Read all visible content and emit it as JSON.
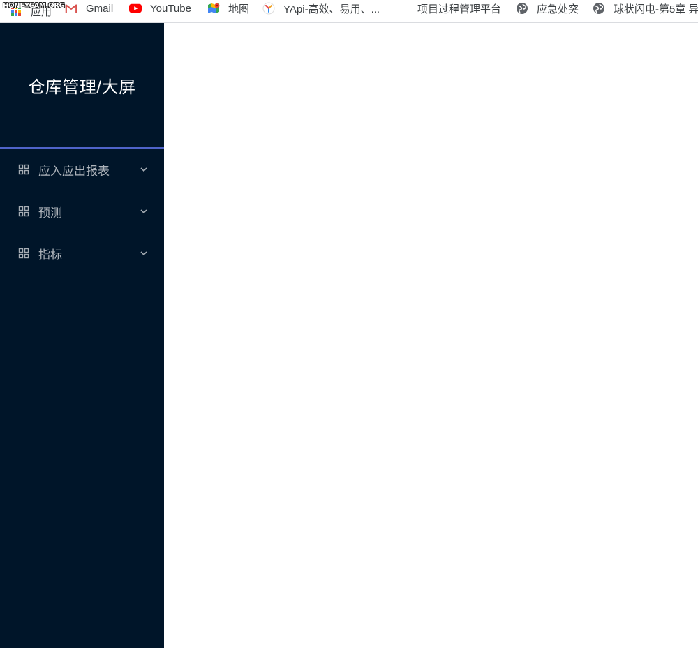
{
  "watermark": "HONEYCAM.ORG",
  "bookmarks": [
    {
      "label": "应用",
      "icon": "apps-grid-icon"
    },
    {
      "label": "Gmail",
      "icon": "gmail-icon"
    },
    {
      "label": "YouTube",
      "icon": "youtube-icon"
    },
    {
      "label": "地图",
      "icon": "maps-icon"
    },
    {
      "label": "YApi-高效、易用、...",
      "icon": "yapi-icon"
    },
    {
      "label": "项目过程管理平台",
      "icon": ""
    },
    {
      "label": "应急处突",
      "icon": "globe-icon"
    },
    {
      "label": "球状闪电-第5章 异",
      "icon": "globe-icon"
    }
  ],
  "sidebar": {
    "title": "仓库管理/大屏",
    "accent_color": "#4f63c9",
    "background_color": "#001529",
    "items": [
      {
        "label": "应入应出报表",
        "icon": "appstore-icon",
        "expand_icon": "chevron-down-icon"
      },
      {
        "label": "预测",
        "icon": "appstore-icon",
        "expand_icon": "chevron-down-icon"
      },
      {
        "label": "指标",
        "icon": "appstore-icon",
        "expand_icon": "chevron-down-icon"
      }
    ]
  }
}
